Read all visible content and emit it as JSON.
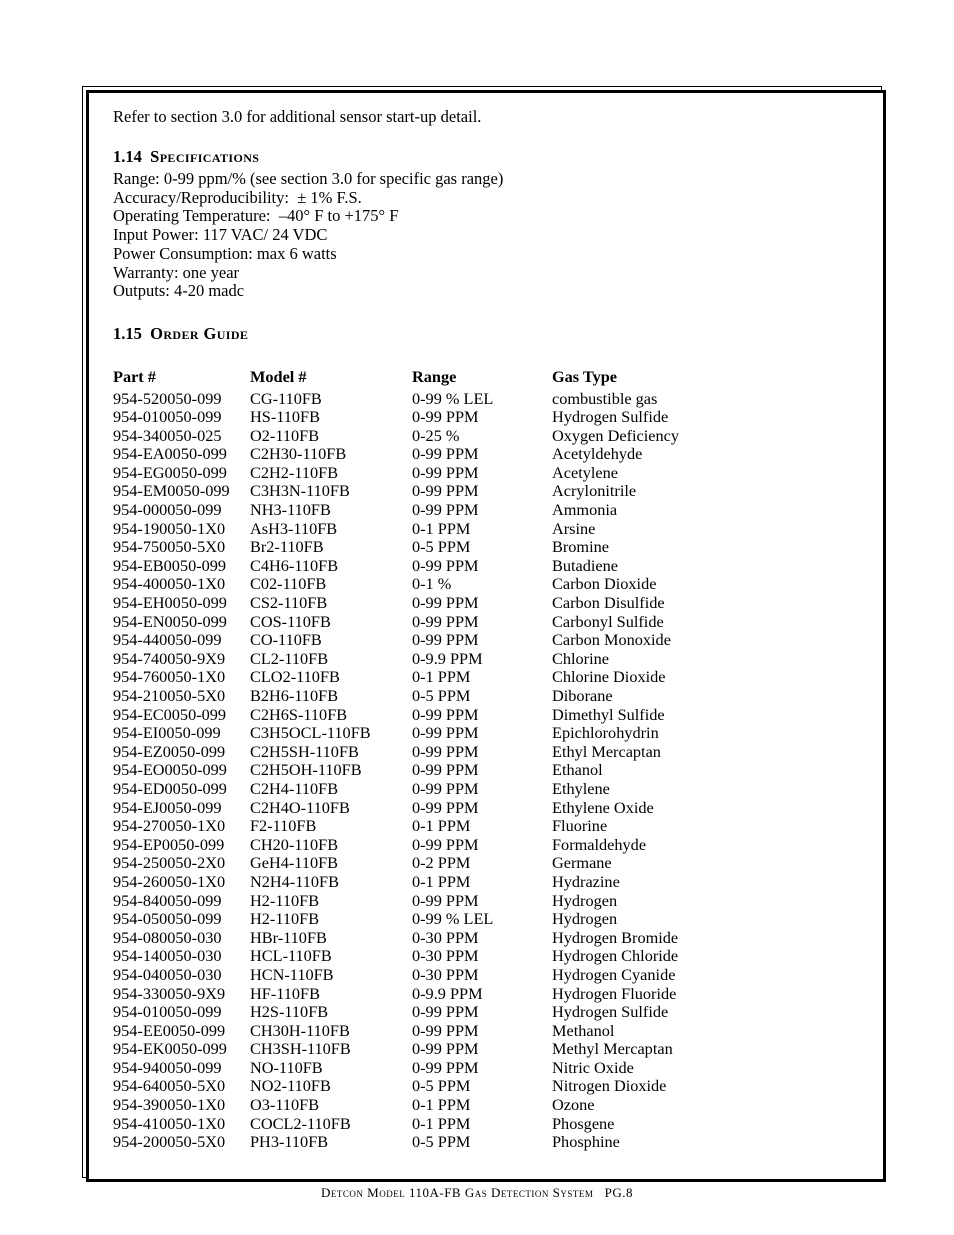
{
  "document": {
    "intro": "Refer to section 3.0 for additional sensor start-up detail.",
    "footer": "Detcon Model 110A-FB Gas Detection System   PG.8"
  },
  "specifications": {
    "number": "1.14",
    "title": "Specifications",
    "items": [
      "Range: 0-99 ppm/% (see section 3.0 for specific gas range)",
      "Accuracy/Reproducibility:  ± 1% F.S.",
      "Operating Temperature:  –40° F to +175° F",
      "Input Power: 117 VAC/ 24 VDC",
      "Power Consumption: max 6 watts",
      "Warranty: one year",
      "Outputs: 4-20 madc"
    ]
  },
  "order_guide": {
    "number": "1.15",
    "title": "Order Guide",
    "columns": [
      "Part #",
      "Model #",
      "Range",
      "Gas Type"
    ],
    "rows": [
      [
        "954-520050-099",
        "CG-110FB",
        "0-99 % LEL",
        "combustible gas"
      ],
      [
        "954-010050-099",
        "HS-110FB",
        "0-99 PPM",
        "Hydrogen Sulfide"
      ],
      [
        "954-340050-025",
        "O2-110FB",
        "0-25 %",
        "Oxygen Deficiency"
      ],
      [
        "954-EA0050-099",
        "C2H30-110FB",
        "0-99 PPM",
        "Acetyldehyde"
      ],
      [
        "954-EG0050-099",
        "C2H2-110FB",
        "0-99 PPM",
        "Acetylene"
      ],
      [
        "954-EM0050-099",
        "C3H3N-110FB",
        "0-99 PPM",
        "Acrylonitrile"
      ],
      [
        "954-000050-099",
        "NH3-110FB",
        "0-99 PPM",
        "Ammonia"
      ],
      [
        "954-190050-1X0",
        "AsH3-110FB",
        "0-1 PPM",
        "Arsine"
      ],
      [
        "954-750050-5X0",
        "Br2-110FB",
        "0-5 PPM",
        "Bromine"
      ],
      [
        "954-EB0050-099",
        "C4H6-110FB",
        "0-99 PPM",
        "Butadiene"
      ],
      [
        "954-400050-1X0",
        "C02-110FB",
        "0-1 %",
        "Carbon Dioxide"
      ],
      [
        "954-EH0050-099",
        "CS2-110FB",
        "0-99 PPM",
        "Carbon Disulfide"
      ],
      [
        "954-EN0050-099",
        "COS-110FB",
        "0-99 PPM",
        "Carbonyl Sulfide"
      ],
      [
        "954-440050-099",
        "CO-110FB",
        "0-99 PPM",
        "Carbon Monoxide"
      ],
      [
        "954-740050-9X9",
        "CL2-110FB",
        "0-9.9 PPM",
        "Chlorine"
      ],
      [
        "954-760050-1X0",
        "CLO2-110FB",
        "0-1 PPM",
        "Chlorine Dioxide"
      ],
      [
        "954-210050-5X0",
        "B2H6-110FB",
        "0-5 PPM",
        "Diborane"
      ],
      [
        "954-EC0050-099",
        "C2H6S-110FB",
        "0-99 PPM",
        "Dimethyl Sulfide"
      ],
      [
        "954-EI0050-099",
        "C3H5OCL-110FB",
        "0-99 PPM",
        "Epichlorohydrin"
      ],
      [
        "954-EZ0050-099",
        "C2H5SH-110FB",
        "0-99 PPM",
        "Ethyl Mercaptan"
      ],
      [
        "954-EO0050-099",
        "C2H5OH-110FB",
        "0-99 PPM",
        "Ethanol"
      ],
      [
        "954-ED0050-099",
        "C2H4-110FB",
        "0-99 PPM",
        "Ethylene"
      ],
      [
        "954-EJ0050-099",
        "C2H4O-110FB",
        "0-99 PPM",
        "Ethylene Oxide"
      ],
      [
        "954-270050-1X0",
        "F2-110FB",
        "0-1 PPM",
        "Fluorine"
      ],
      [
        "954-EP0050-099",
        "CH20-110FB",
        "0-99 PPM",
        "Formaldehyde"
      ],
      [
        "954-250050-2X0",
        "GeH4-110FB",
        "0-2 PPM",
        "Germane"
      ],
      [
        "954-260050-1X0",
        "N2H4-110FB",
        "0-1 PPM",
        "Hydrazine"
      ],
      [
        "954-840050-099",
        "H2-110FB",
        "0-99 PPM",
        "Hydrogen"
      ],
      [
        "954-050050-099",
        "H2-110FB",
        "0-99 % LEL",
        "Hydrogen"
      ],
      [
        "954-080050-030",
        "HBr-110FB",
        "0-30 PPM",
        "Hydrogen Bromide"
      ],
      [
        "954-140050-030",
        "HCL-110FB",
        "0-30 PPM",
        "Hydrogen Chloride"
      ],
      [
        "954-040050-030",
        "HCN-110FB",
        "0-30 PPM",
        "Hydrogen Cyanide"
      ],
      [
        "954-330050-9X9",
        "HF-110FB",
        "0-9.9 PPM",
        "Hydrogen Fluoride"
      ],
      [
        "954-010050-099",
        "H2S-110FB",
        "0-99 PPM",
        "Hydrogen Sulfide"
      ],
      [
        "954-EE0050-099",
        "CH30H-110FB",
        "0-99 PPM",
        "Methanol"
      ],
      [
        "954-EK0050-099",
        "CH3SH-110FB",
        "0-99 PPM",
        "Methyl Mercaptan"
      ],
      [
        "954-940050-099",
        "NO-110FB",
        "0-99 PPM",
        "Nitric Oxide"
      ],
      [
        "954-640050-5X0",
        "NO2-110FB",
        "0-5 PPM",
        "Nitrogen Dioxide"
      ],
      [
        "954-390050-1X0",
        "O3-110FB",
        "0-1 PPM",
        "Ozone"
      ],
      [
        "954-410050-1X0",
        "COCL2-110FB",
        "0-1 PPM",
        "Phosgene"
      ],
      [
        "954-200050-5X0",
        "PH3-110FB",
        "0-5 PPM",
        "Phosphine"
      ]
    ]
  }
}
